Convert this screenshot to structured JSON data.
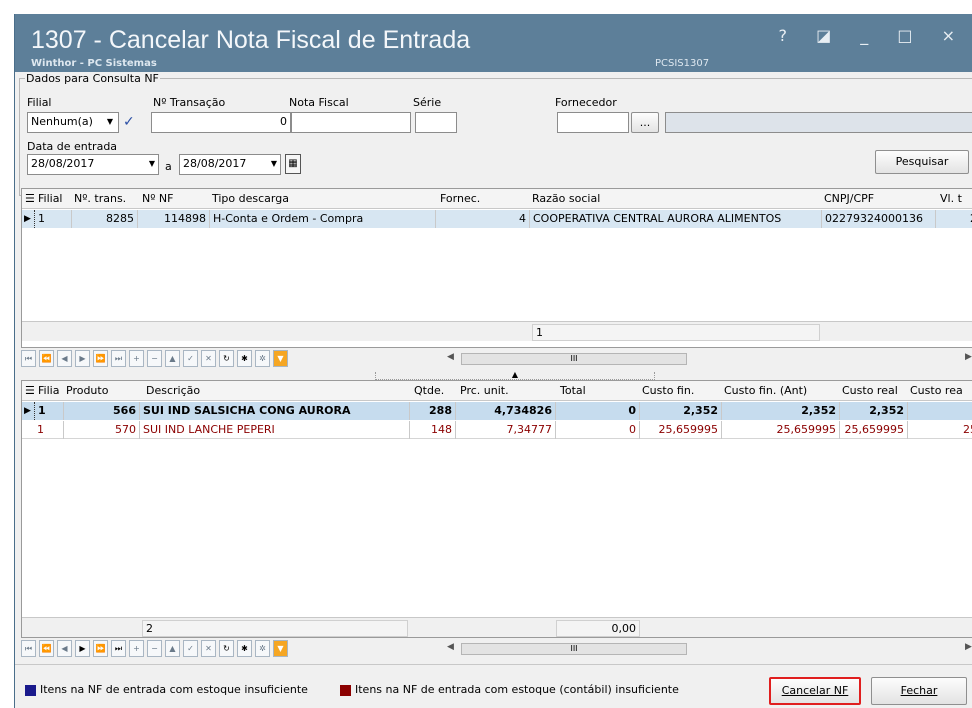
{
  "window": {
    "title": "1307 - Cancelar Nota Fiscal de  Entrada",
    "subtitle": "Winthor - PC Sistemas",
    "code": "PCSIS1307",
    "controls": "? ◪ _ □ ×"
  },
  "filter": {
    "legend": "Dados para Consulta NF",
    "filial_label": "Filial",
    "filial_value": "Nenhum(a)",
    "transacao_label": "Nº Transação",
    "transacao_value": "0",
    "nota_label": "Nota Fiscal",
    "nota_value": "",
    "serie_label": "Série",
    "serie_value": "",
    "fornecedor_label": "Fornecedor",
    "fornecedor_value": "",
    "fornecedor_browse": "...",
    "data_label": "Data de entrada",
    "data_de": "28/08/2017",
    "data_a_label": "a",
    "data_ate": "28/08/2017",
    "pesquisar_label": "Pesquisar"
  },
  "grid1": {
    "headers": [
      "Filial",
      "Nº. trans.",
      "Nº NF",
      "Tipo descarga",
      "Fornec.",
      "Razão social",
      "CNPJ/CPF",
      "Vl. t"
    ],
    "rows": [
      [
        "1",
        "8285",
        "114898",
        "H-Conta e Ordem - Compra",
        "4",
        "COOPERATIVA CENTRAL AURORA ALIMENTOS",
        "02279324000136",
        "2"
      ]
    ],
    "footer_count": "1"
  },
  "grid2": {
    "headers": [
      "Filia",
      "Produto",
      "Descrição",
      "Qtde.",
      "Prc. unit.",
      "Total",
      "Custo fin.",
      "Custo fin. (Ant)",
      "Custo real",
      "Custo rea"
    ],
    "rows": [
      [
        "1",
        "566",
        "SUI IND SALSICHA CONG AURORA",
        "288",
        "4,734826",
        "0",
        "2,352",
        "2,352",
        "2,352",
        ""
      ],
      [
        "1",
        "570",
        "SUI IND LANCHE PEPERI",
        "148",
        "7,34777",
        "0",
        "25,659995",
        "25,659995",
        "25,659995",
        "25"
      ]
    ],
    "footer_count": "2",
    "footer_total": "0,00"
  },
  "legend": {
    "blue_color": "#1a1a8c",
    "red_color": "#8b0000",
    "blue_text": "Itens na NF de entrada com estoque insuficiente",
    "red_text": "Itens na NF de entrada com estoque (contábil) insuficiente",
    "cancelar_label": "Cancelar NF",
    "fechar_label": "Fechar"
  },
  "scroll": {
    "thumb_glyph": "III"
  }
}
